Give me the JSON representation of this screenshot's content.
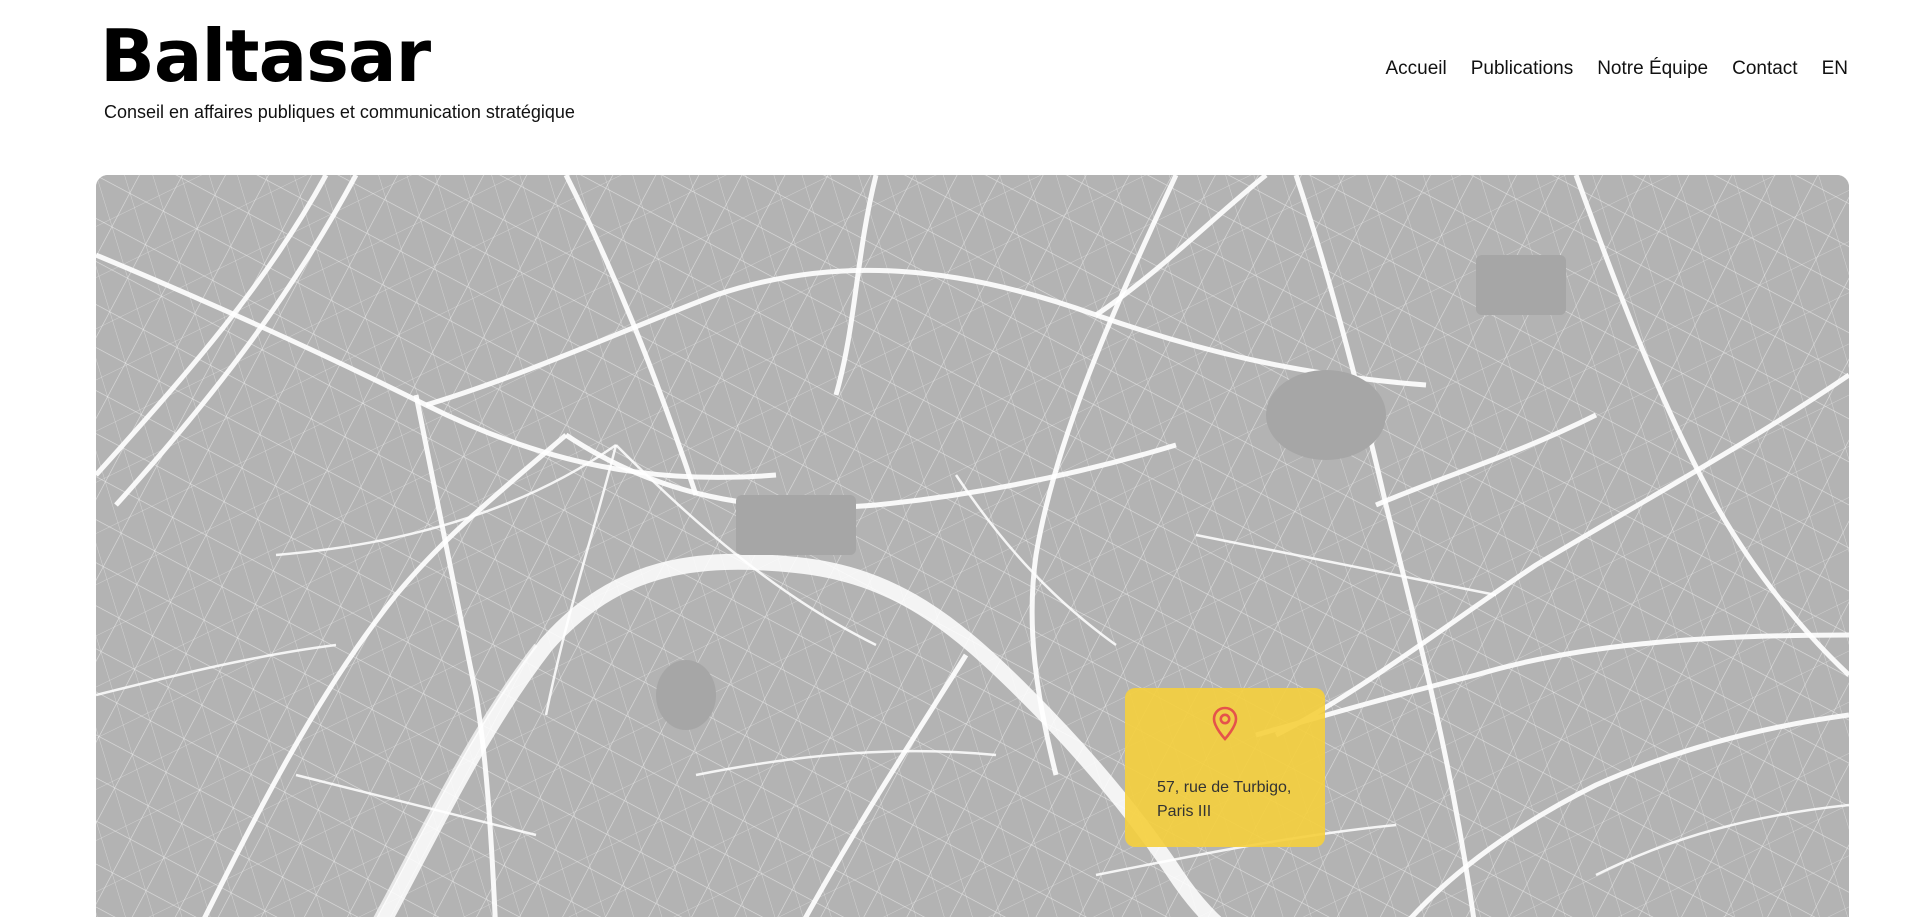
{
  "brand": {
    "name": "Baltasar",
    "tagline": "Conseil en affaires publiques et communication stratégique"
  },
  "nav": {
    "items": [
      {
        "label": "Accueil"
      },
      {
        "label": "Publications"
      },
      {
        "label": "Notre Équipe"
      },
      {
        "label": "Contact"
      },
      {
        "label": "EN"
      }
    ]
  },
  "map": {
    "address_line1": "57, rue de Turbigo,",
    "address_line2": "Paris III",
    "marker_icon": "location-pin-icon"
  },
  "colors": {
    "map_background": "#b3b3b3",
    "roads": "#ffffff",
    "marker_card": "#f5cf3c",
    "pin": "#e5534b"
  }
}
